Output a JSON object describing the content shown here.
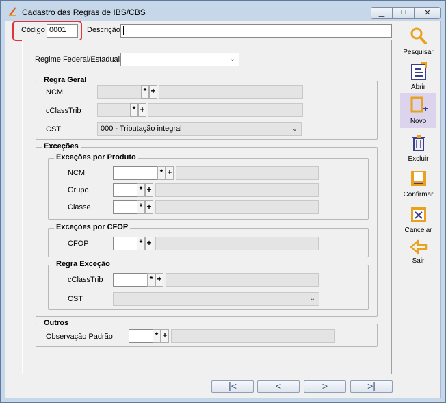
{
  "window": {
    "title": "Cadastro das Regras de IBS/CBS",
    "minimize_glyph": "▁",
    "maximize_glyph": "□",
    "close_glyph": "✕"
  },
  "header": {
    "codigo_label": "Código",
    "codigo_value": "0001",
    "descricao_label": "Descrição",
    "descricao_value": ""
  },
  "regime": {
    "label": "Regime Federal/Estadual",
    "value": ""
  },
  "regra_geral": {
    "title": "Regra Geral",
    "ncm_label": "NCM",
    "cclasstrib_label": "cClassTrib",
    "cst_label": "CST",
    "cst_value": "000 - Tributação integral"
  },
  "excecoes": {
    "title": "Exceções",
    "produto": {
      "title": "Exceções por Produto",
      "ncm_label": "NCM",
      "grupo_label": "Grupo",
      "classe_label": "Classe"
    },
    "cfop": {
      "title": "Exceções por CFOP",
      "cfop_label": "CFOP"
    },
    "regra": {
      "title": "Regra Exceção",
      "cclasstrib_label": "cClassTrib",
      "cst_label": "CST",
      "cst_value": ""
    }
  },
  "outros": {
    "title": "Outros",
    "obs_label": "Observação Padrão"
  },
  "buttons": {
    "star": "*",
    "plus": "+"
  },
  "toolbar": {
    "pesquisar": "Pesquisar",
    "abrir": "Abrir",
    "novo": "Novo",
    "excluir": "Excluir",
    "confirmar": "Confirmar",
    "cancelar": "Cancelar",
    "sair": "Sair"
  },
  "navigation": {
    "first": "|<",
    "prev": "<",
    "next": ">",
    "last": ">|"
  },
  "colors": {
    "accent": "#e9a21f",
    "highlight_border": "#e0333a",
    "active_tool_bg": "#dcd3ec"
  }
}
